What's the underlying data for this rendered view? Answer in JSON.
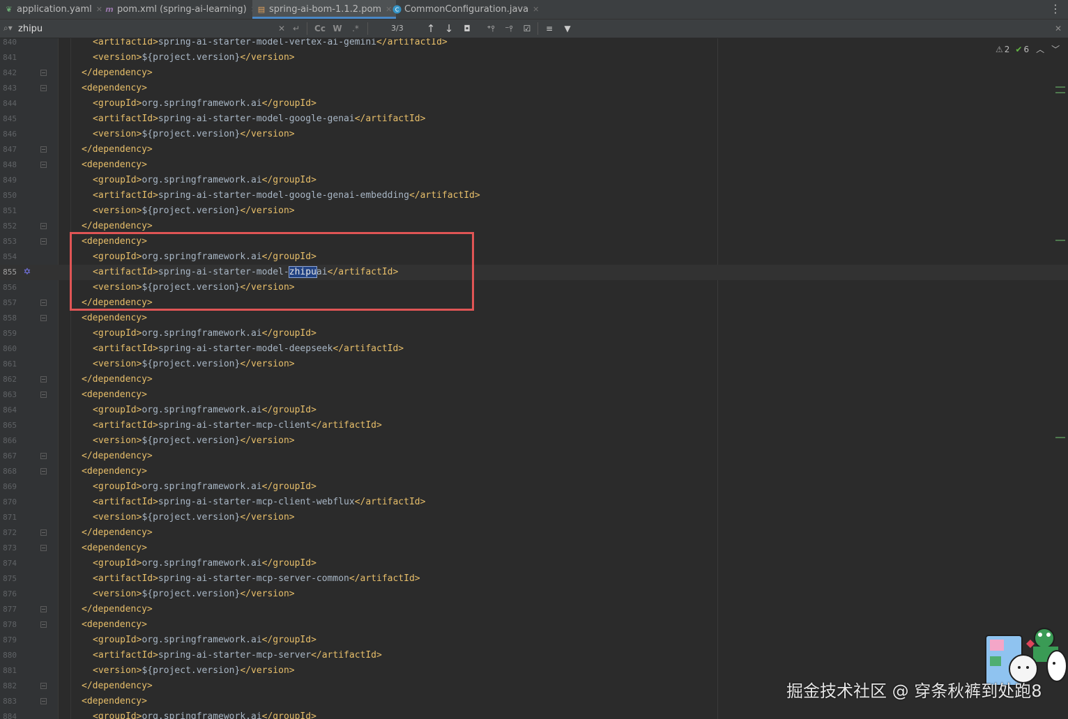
{
  "tabs": [
    {
      "label": "application.yaml",
      "icon": "spring-leaf-icon"
    },
    {
      "label": "pom.xml (spring-ai-learning)",
      "icon": "maven-icon"
    },
    {
      "label": "spring-ai-bom-1.1.2.pom",
      "icon": "xml-file-icon",
      "active": true
    },
    {
      "label": "CommonConfiguration.java",
      "icon": "java-class-icon"
    }
  ],
  "search": {
    "query": "zhipu",
    "match_case": "Cc",
    "words": "W",
    "count": "3/3"
  },
  "inspections": {
    "warnings": "2",
    "ok": "6"
  },
  "lines": [
    {
      "n": "840",
      "indent": 2,
      "parts": [
        [
          "t",
          "<artifactId>"
        ],
        [
          "x",
          "spring-ai-starter-model-vertex-ai-gemini"
        ],
        [
          "t",
          "</artifactId>"
        ]
      ]
    },
    {
      "n": "841",
      "indent": 2,
      "parts": [
        [
          "t",
          "<version>"
        ],
        [
          "x",
          "${project.version}"
        ],
        [
          "t",
          "</version>"
        ]
      ]
    },
    {
      "n": "842",
      "indent": 1,
      "fold": true,
      "parts": [
        [
          "t",
          "</dependency>"
        ]
      ]
    },
    {
      "n": "843",
      "indent": 1,
      "fold": true,
      "parts": [
        [
          "t",
          "<dependency>"
        ]
      ]
    },
    {
      "n": "844",
      "indent": 2,
      "parts": [
        [
          "t",
          "<groupId>"
        ],
        [
          "x",
          "org.springframework.ai"
        ],
        [
          "t",
          "</groupId>"
        ]
      ]
    },
    {
      "n": "845",
      "indent": 2,
      "parts": [
        [
          "t",
          "<artifactId>"
        ],
        [
          "x",
          "spring-ai-starter-model-google-genai"
        ],
        [
          "t",
          "</artifactId>"
        ]
      ]
    },
    {
      "n": "846",
      "indent": 2,
      "parts": [
        [
          "t",
          "<version>"
        ],
        [
          "x",
          "${project.version}"
        ],
        [
          "t",
          "</version>"
        ]
      ]
    },
    {
      "n": "847",
      "indent": 1,
      "fold": true,
      "parts": [
        [
          "t",
          "</dependency>"
        ]
      ]
    },
    {
      "n": "848",
      "indent": 1,
      "fold": true,
      "parts": [
        [
          "t",
          "<dependency>"
        ]
      ]
    },
    {
      "n": "849",
      "indent": 2,
      "parts": [
        [
          "t",
          "<groupId>"
        ],
        [
          "x",
          "org.springframework.ai"
        ],
        [
          "t",
          "</groupId>"
        ]
      ]
    },
    {
      "n": "850",
      "indent": 2,
      "parts": [
        [
          "t",
          "<artifactId>"
        ],
        [
          "x",
          "spring-ai-starter-model-google-genai-embedding"
        ],
        [
          "t",
          "</artifactId>"
        ]
      ]
    },
    {
      "n": "851",
      "indent": 2,
      "parts": [
        [
          "t",
          "<version>"
        ],
        [
          "x",
          "${project.version}"
        ],
        [
          "t",
          "</version>"
        ]
      ]
    },
    {
      "n": "852",
      "indent": 1,
      "fold": true,
      "parts": [
        [
          "t",
          "</dependency>"
        ]
      ]
    },
    {
      "n": "853",
      "indent": 1,
      "fold": true,
      "parts": [
        [
          "t",
          "<dependency>"
        ]
      ]
    },
    {
      "n": "854",
      "indent": 2,
      "parts": [
        [
          "t",
          "<groupId>"
        ],
        [
          "x",
          "org.springframework.ai"
        ],
        [
          "t",
          "</groupId>"
        ]
      ]
    },
    {
      "n": "855",
      "indent": 2,
      "current": true,
      "parts": [
        [
          "t",
          "<artifactId>"
        ],
        [
          "x",
          "spring-ai-starter-model-"
        ],
        [
          "h",
          "zhipu"
        ],
        [
          "x",
          "ai"
        ],
        [
          "t",
          "</artifactId>"
        ]
      ]
    },
    {
      "n": "856",
      "indent": 2,
      "parts": [
        [
          "t",
          "<version>"
        ],
        [
          "x",
          "${project.version}"
        ],
        [
          "t",
          "</version>"
        ]
      ]
    },
    {
      "n": "857",
      "indent": 1,
      "fold": true,
      "parts": [
        [
          "t",
          "</dependency>"
        ]
      ]
    },
    {
      "n": "858",
      "indent": 1,
      "fold": true,
      "parts": [
        [
          "t",
          "<dependency>"
        ]
      ]
    },
    {
      "n": "859",
      "indent": 2,
      "parts": [
        [
          "t",
          "<groupId>"
        ],
        [
          "x",
          "org.springframework.ai"
        ],
        [
          "t",
          "</groupId>"
        ]
      ]
    },
    {
      "n": "860",
      "indent": 2,
      "parts": [
        [
          "t",
          "<artifactId>"
        ],
        [
          "x",
          "spring-ai-starter-model-deepseek"
        ],
        [
          "t",
          "</artifactId>"
        ]
      ]
    },
    {
      "n": "861",
      "indent": 2,
      "parts": [
        [
          "t",
          "<version>"
        ],
        [
          "x",
          "${project.version}"
        ],
        [
          "t",
          "</version>"
        ]
      ]
    },
    {
      "n": "862",
      "indent": 1,
      "fold": true,
      "parts": [
        [
          "t",
          "</dependency>"
        ]
      ]
    },
    {
      "n": "863",
      "indent": 1,
      "fold": true,
      "parts": [
        [
          "t",
          "<dependency>"
        ]
      ]
    },
    {
      "n": "864",
      "indent": 2,
      "parts": [
        [
          "t",
          "<groupId>"
        ],
        [
          "x",
          "org.springframework.ai"
        ],
        [
          "t",
          "</groupId>"
        ]
      ]
    },
    {
      "n": "865",
      "indent": 2,
      "parts": [
        [
          "t",
          "<artifactId>"
        ],
        [
          "x",
          "spring-ai-starter-mcp-client"
        ],
        [
          "t",
          "</artifactId>"
        ]
      ]
    },
    {
      "n": "866",
      "indent": 2,
      "parts": [
        [
          "t",
          "<version>"
        ],
        [
          "x",
          "${project.version}"
        ],
        [
          "t",
          "</version>"
        ]
      ]
    },
    {
      "n": "867",
      "indent": 1,
      "fold": true,
      "parts": [
        [
          "t",
          "</dependency>"
        ]
      ]
    },
    {
      "n": "868",
      "indent": 1,
      "fold": true,
      "parts": [
        [
          "t",
          "<dependency>"
        ]
      ]
    },
    {
      "n": "869",
      "indent": 2,
      "parts": [
        [
          "t",
          "<groupId>"
        ],
        [
          "x",
          "org.springframework.ai"
        ],
        [
          "t",
          "</groupId>"
        ]
      ]
    },
    {
      "n": "870",
      "indent": 2,
      "parts": [
        [
          "t",
          "<artifactId>"
        ],
        [
          "x",
          "spring-ai-starter-mcp-client-webflux"
        ],
        [
          "t",
          "</artifactId>"
        ]
      ]
    },
    {
      "n": "871",
      "indent": 2,
      "parts": [
        [
          "t",
          "<version>"
        ],
        [
          "x",
          "${project.version}"
        ],
        [
          "t",
          "</version>"
        ]
      ]
    },
    {
      "n": "872",
      "indent": 1,
      "fold": true,
      "parts": [
        [
          "t",
          "</dependency>"
        ]
      ]
    },
    {
      "n": "873",
      "indent": 1,
      "fold": true,
      "parts": [
        [
          "t",
          "<dependency>"
        ]
      ]
    },
    {
      "n": "874",
      "indent": 2,
      "parts": [
        [
          "t",
          "<groupId>"
        ],
        [
          "x",
          "org.springframework.ai"
        ],
        [
          "t",
          "</groupId>"
        ]
      ]
    },
    {
      "n": "875",
      "indent": 2,
      "parts": [
        [
          "t",
          "<artifactId>"
        ],
        [
          "x",
          "spring-ai-starter-mcp-server-common"
        ],
        [
          "t",
          "</artifactId>"
        ]
      ]
    },
    {
      "n": "876",
      "indent": 2,
      "parts": [
        [
          "t",
          "<version>"
        ],
        [
          "x",
          "${project.version}"
        ],
        [
          "t",
          "</version>"
        ]
      ]
    },
    {
      "n": "877",
      "indent": 1,
      "fold": true,
      "parts": [
        [
          "t",
          "</dependency>"
        ]
      ]
    },
    {
      "n": "878",
      "indent": 1,
      "fold": true,
      "parts": [
        [
          "t",
          "<dependency>"
        ]
      ]
    },
    {
      "n": "879",
      "indent": 2,
      "parts": [
        [
          "t",
          "<groupId>"
        ],
        [
          "x",
          "org.springframework.ai"
        ],
        [
          "t",
          "</groupId>"
        ]
      ]
    },
    {
      "n": "880",
      "indent": 2,
      "parts": [
        [
          "t",
          "<artifactId>"
        ],
        [
          "x",
          "spring-ai-starter-mcp-server"
        ],
        [
          "t",
          "</artifactId>"
        ]
      ]
    },
    {
      "n": "881",
      "indent": 2,
      "parts": [
        [
          "t",
          "<version>"
        ],
        [
          "x",
          "${project.version}"
        ],
        [
          "t",
          "</version>"
        ]
      ]
    },
    {
      "n": "882",
      "indent": 1,
      "fold": true,
      "parts": [
        [
          "t",
          "</dependency>"
        ]
      ]
    },
    {
      "n": "883",
      "indent": 1,
      "fold": true,
      "parts": [
        [
          "t",
          "<dependency>"
        ]
      ]
    },
    {
      "n": "884",
      "indent": 2,
      "parts": [
        [
          "t",
          "<groupId>"
        ],
        [
          "x",
          "org.springframework.ai"
        ],
        [
          "t",
          "</groupId>"
        ]
      ]
    }
  ],
  "watermark": "掘金技术社区 @ 穿条秋裤到处跑8",
  "colors": {
    "tag": "#e8bf6a",
    "text": "#a9b7c6",
    "match": "#214283",
    "annotation": "#e05555"
  }
}
